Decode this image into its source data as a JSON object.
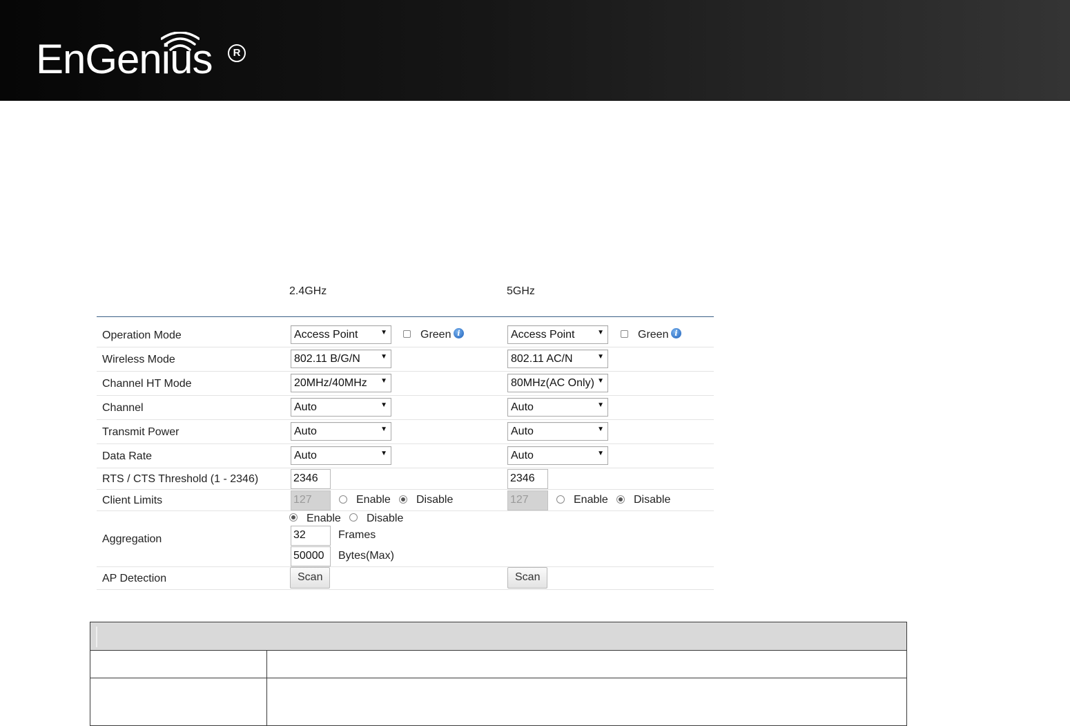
{
  "brand": {
    "name": "EnGenius",
    "registered": "R"
  },
  "columns": {
    "band_24": "2.4GHz",
    "band_5": "5GHz"
  },
  "rows": {
    "operation_mode": {
      "label": "Operation Mode",
      "val_24": "Access Point",
      "val_5": "Access Point",
      "green_label": "Green"
    },
    "wireless_mode": {
      "label": "Wireless Mode",
      "val_24": "802.11 B/G/N",
      "val_5": "802.11 AC/N"
    },
    "channel_ht_mode": {
      "label": "Channel HT Mode",
      "val_24": "20MHz/40MHz",
      "val_5": "80MHz(AC Only)"
    },
    "channel": {
      "label": "Channel",
      "val_24": "Auto",
      "val_5": "Auto"
    },
    "transmit_power": {
      "label": "Transmit Power",
      "val_24": "Auto",
      "val_5": "Auto"
    },
    "data_rate": {
      "label": "Data Rate",
      "val_24": "Auto",
      "val_5": "Auto"
    },
    "rts_cts": {
      "label": "RTS / CTS Threshold (1 - 2346)",
      "val_24": "2346",
      "val_5": "2346"
    },
    "client_limits": {
      "label": "Client Limits",
      "val_24": "127",
      "val_5": "127",
      "enable": "Enable",
      "disable": "Disable"
    },
    "aggregation": {
      "label": "Aggregation",
      "enable": "Enable",
      "disable": "Disable",
      "frames_value": "32",
      "frames_unit": "Frames",
      "bytes_value": "50000",
      "bytes_unit": "Bytes(Max)"
    },
    "ap_detection": {
      "label": "AP Detection",
      "scan_label": "Scan"
    }
  },
  "icons": {
    "dropdown": "chevron-down-icon",
    "info": "info-icon",
    "wifi": "wifi-signal-icon"
  },
  "colors": {
    "header_dark": "#060606",
    "header_light": "#343434",
    "rule_blue": "#3a5f86",
    "info_blue": "#1c5fb8",
    "desc_header_bg": "#d9d9d9"
  }
}
